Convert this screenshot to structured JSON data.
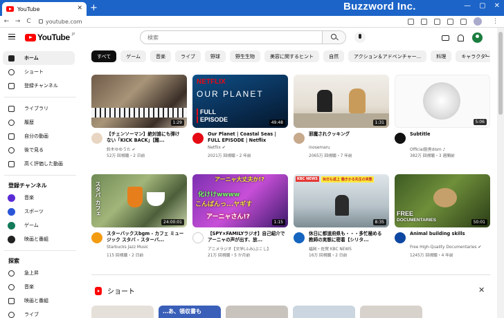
{
  "browser": {
    "tab_title": "YouTube",
    "address": "youtube.com",
    "new_tab_label": "+",
    "watermark": "Buzzword Inc.",
    "win_min": "—",
    "win_max": "▢",
    "win_close": "✕",
    "tab_close": "✕",
    "back": "←",
    "forward": "→",
    "reload": "C"
  },
  "header": {
    "logo_text": "YouTube",
    "logo_suffix": "JP",
    "search_placeholder": "検索"
  },
  "sidebar": {
    "main": [
      "ホーム",
      "ショート",
      "登録チャンネル"
    ],
    "library": [
      "ライブラリ",
      "履歴",
      "自分の動画",
      "後で見る",
      "高く評価した動画"
    ],
    "subscriptions_title": "登録チャンネル",
    "subscriptions": [
      "音楽",
      "スポーツ",
      "ゲーム",
      "映画と番組"
    ],
    "explore_title": "探索",
    "explore": [
      "急上昇",
      "音楽",
      "映画と番組",
      "ライブ"
    ]
  },
  "chips": [
    "すべて",
    "ゲーム",
    "音楽",
    "ライブ",
    "野球",
    "野生生物",
    "美容に関するヒント",
    "自然",
    "アクション＆アドベンチャー...",
    "料理",
    "キャラクター ア"
  ],
  "chips_next": "›",
  "videos": [
    {
      "title": "【チェンソーマン】絶対誰にも弾けない「KICK BACK」【難...",
      "channel": "鈴木ゆゆうた ✔",
      "stats": "52万 回視聴・2 日前",
      "duration": "1:29"
    },
    {
      "title": "Our Planet | Coastal Seas | FULL EPISODE | Netflix",
      "channel": "Netflix ✔",
      "stats": "2021万 回視聴・2 年前",
      "duration": "49:48",
      "thumb_brand": "NETFLIX",
      "thumb_title": "OUR PLANET",
      "thumb_sub1": "FULL",
      "thumb_sub2": "EPISODE"
    },
    {
      "title": "邪魔されクッキング",
      "channel": "inosemaru",
      "stats": "2065万 回視聴・7 年前",
      "duration": "1:31"
    },
    {
      "title": "Subtitle",
      "channel": "Official髭男dism ♪",
      "stats": "382万 回視聴・3 週間前",
      "duration": "5:06"
    },
    {
      "title": "スターバックスbgm - カフェ ミュージック スタバ - スターバ...",
      "channel": "Starbucks Jazz Music",
      "stats": "115 回視聴・2 日前",
      "duration": "24:00:01",
      "thumb_text": "スタバ カフェ"
    },
    {
      "title": "【SPY×FAMILYラジオ】自己紹介でアーニャの声が出す、放...",
      "channel": "アニメラジオ【文学(ふみ)ぶこし】",
      "stats": "21万 回視聴・5 か月前",
      "duration": "1:15",
      "thumb_line1": "アーニャ大丈夫か!?",
      "thumb_line2": "化けけwwww",
      "thumb_line3": "こんばんっ...ヤギす",
      "thumb_line4": "アーニャさん!?"
    },
    {
      "title": "休日に都道府県も・・・多忙極める教師の実態に密着【シリタ...",
      "channel": "福岡・佐賀 KBC NEWS",
      "stats": "16万 回視聴・2 日前",
      "duration": "8:35",
      "thumb_tag": "KBC NEWS",
      "thumb_headline": "休日も返上 働きかる先生の実態"
    },
    {
      "title": "Animal building skills",
      "channel": "Free High-Quality Documentaries ✔",
      "stats": "1245万 回視聴・4 年前",
      "duration": "50:01",
      "thumb_text1": "FREE",
      "thumb_text2": "DOCUMENTARIES"
    }
  ],
  "shorts": {
    "title": "ショート",
    "close": "✕",
    "items": [
      "",
      "…あ、領収書も",
      "",
      "",
      ""
    ]
  },
  "colors": {
    "titlebar": "#1c64c8",
    "youtube_red": "#ff0000",
    "chip_active": "#0f0f0f"
  }
}
